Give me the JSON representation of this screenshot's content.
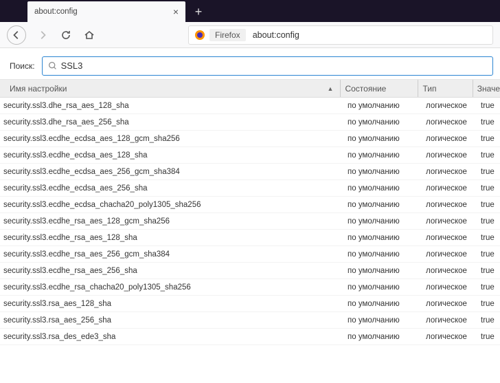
{
  "tab": {
    "title": "about:config"
  },
  "urlbar": {
    "identity_label": "Firefox",
    "url": "about:config"
  },
  "search": {
    "label": "Поиск:",
    "value": "SSL3"
  },
  "columns": {
    "name": "Имя настройки",
    "state": "Состояние",
    "type": "Тип",
    "value": "Значе"
  },
  "prefs": [
    {
      "name": "security.ssl3.dhe_rsa_aes_128_sha",
      "state": "по умолчанию",
      "type": "логическое",
      "value": "true"
    },
    {
      "name": "security.ssl3.dhe_rsa_aes_256_sha",
      "state": "по умолчанию",
      "type": "логическое",
      "value": "true"
    },
    {
      "name": "security.ssl3.ecdhe_ecdsa_aes_128_gcm_sha256",
      "state": "по умолчанию",
      "type": "логическое",
      "value": "true"
    },
    {
      "name": "security.ssl3.ecdhe_ecdsa_aes_128_sha",
      "state": "по умолчанию",
      "type": "логическое",
      "value": "true"
    },
    {
      "name": "security.ssl3.ecdhe_ecdsa_aes_256_gcm_sha384",
      "state": "по умолчанию",
      "type": "логическое",
      "value": "true"
    },
    {
      "name": "security.ssl3.ecdhe_ecdsa_aes_256_sha",
      "state": "по умолчанию",
      "type": "логическое",
      "value": "true"
    },
    {
      "name": "security.ssl3.ecdhe_ecdsa_chacha20_poly1305_sha256",
      "state": "по умолчанию",
      "type": "логическое",
      "value": "true"
    },
    {
      "name": "security.ssl3.ecdhe_rsa_aes_128_gcm_sha256",
      "state": "по умолчанию",
      "type": "логическое",
      "value": "true"
    },
    {
      "name": "security.ssl3.ecdhe_rsa_aes_128_sha",
      "state": "по умолчанию",
      "type": "логическое",
      "value": "true"
    },
    {
      "name": "security.ssl3.ecdhe_rsa_aes_256_gcm_sha384",
      "state": "по умолчанию",
      "type": "логическое",
      "value": "true"
    },
    {
      "name": "security.ssl3.ecdhe_rsa_aes_256_sha",
      "state": "по умолчанию",
      "type": "логическое",
      "value": "true"
    },
    {
      "name": "security.ssl3.ecdhe_rsa_chacha20_poly1305_sha256",
      "state": "по умолчанию",
      "type": "логическое",
      "value": "true"
    },
    {
      "name": "security.ssl3.rsa_aes_128_sha",
      "state": "по умолчанию",
      "type": "логическое",
      "value": "true"
    },
    {
      "name": "security.ssl3.rsa_aes_256_sha",
      "state": "по умолчанию",
      "type": "логическое",
      "value": "true"
    },
    {
      "name": "security.ssl3.rsa_des_ede3_sha",
      "state": "по умолчанию",
      "type": "логическое",
      "value": "true"
    }
  ]
}
